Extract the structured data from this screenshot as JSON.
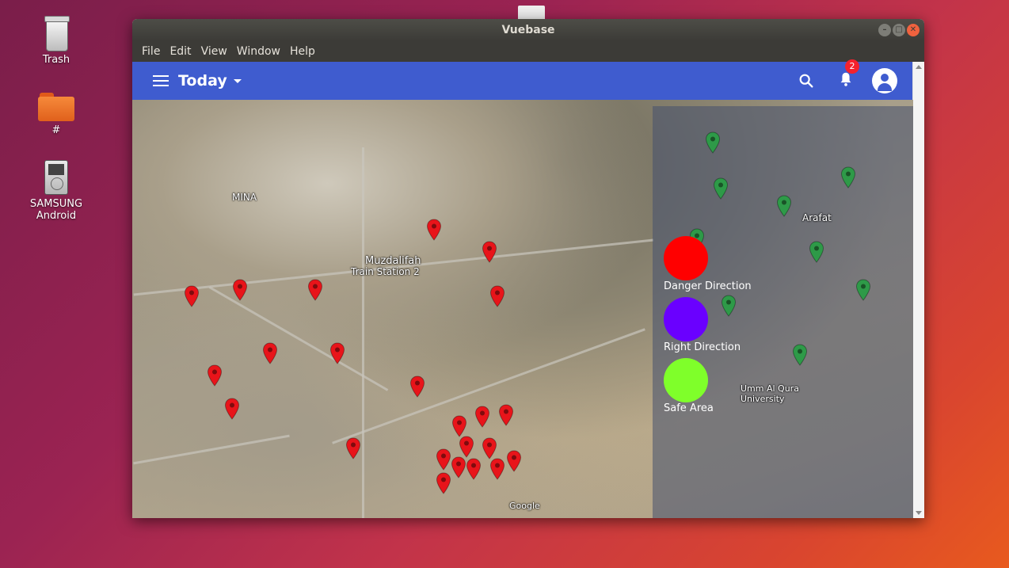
{
  "desktop": {
    "icons": [
      {
        "label": "Trash"
      },
      {
        "label": "#"
      },
      {
        "label": "SAMSUNG Android"
      }
    ]
  },
  "window": {
    "title": "Vuebase",
    "menu": [
      "File",
      "Edit",
      "View",
      "Window",
      "Help"
    ]
  },
  "appbar": {
    "title": "Today",
    "notification_count": "2",
    "color": "#3f5ccf"
  },
  "map": {
    "labels": {
      "mina": "MINA",
      "muzdalifah": "Muzdalifah",
      "train_station": "Train Station 2",
      "arafat": "Arafat",
      "umm_al_qura": "Umm Al Qura University",
      "google": "Google"
    }
  },
  "legend": [
    {
      "label": "Danger Direction",
      "color": "#ff0000"
    },
    {
      "label": "Right Direction",
      "color": "#6a00ff"
    },
    {
      "label": "Safe Area",
      "color": "#7fff2a"
    }
  ],
  "pin_colors": {
    "danger": "#e8141a",
    "safe": "#2e9a48"
  }
}
